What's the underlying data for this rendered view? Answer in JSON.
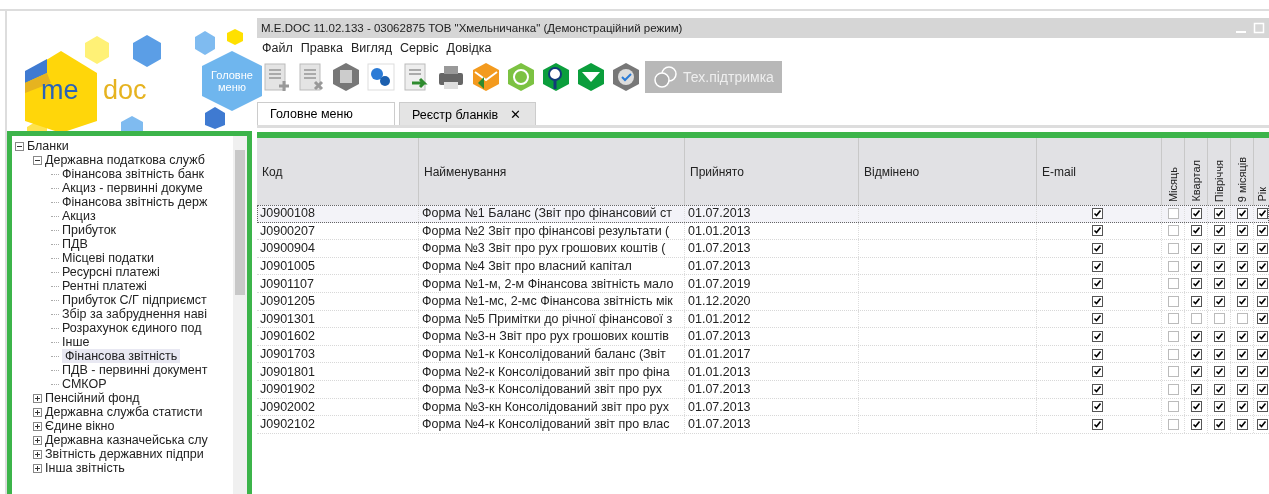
{
  "window": {
    "title": "M.E.DOC 11.02.133  - 03062875 ТОВ \"Хмельничанка\" (Демонстраційний режим)"
  },
  "logo": {
    "left": "me",
    "right": "doc"
  },
  "home_button": {
    "label": "Головне меню"
  },
  "menu": [
    "Файл",
    "Правка",
    "Вигляд",
    "Сервіс",
    "Довідка"
  ],
  "support_button": {
    "label": "Тех.підтримка",
    "disabled": true
  },
  "tabs": [
    {
      "label": "Головне меню",
      "selected": false
    },
    {
      "label": "Реєстр бланків",
      "selected": true,
      "close": "✕"
    }
  ],
  "tree": [
    {
      "label": "Бланки",
      "expanded": true,
      "children": [
        {
          "label": "Державна податкова служб",
          "expanded": true,
          "children": [
            {
              "label": "Фінансова звітність банк",
              "selected": false
            },
            {
              "label": "Акциз - первинні докуме",
              "selected": false
            },
            {
              "label": "Фінансова звітність держ",
              "selected": false
            },
            {
              "label": "Акциз",
              "selected": false
            },
            {
              "label": "Прибуток",
              "selected": false
            },
            {
              "label": "ПДВ",
              "selected": false
            },
            {
              "label": "Місцеві податки",
              "selected": false
            },
            {
              "label": "Ресурсні платежі",
              "selected": false
            },
            {
              "label": "Рентні платежі",
              "selected": false
            },
            {
              "label": "Прибуток С/Г підприємст",
              "selected": false
            },
            {
              "label": "Збір за забруднення наві",
              "selected": false
            },
            {
              "label": "Розрахунок єдиного под",
              "selected": false
            },
            {
              "label": "Інше",
              "selected": false
            },
            {
              "label": "Фінансова звітність",
              "selected": true
            },
            {
              "label": "ПДВ - первинні документ",
              "selected": false
            },
            {
              "label": "СМКОР",
              "selected": false
            }
          ]
        },
        {
          "label": "Пенсійний фонд",
          "expanded": false
        },
        {
          "label": "Державна служба статисти",
          "expanded": false
        },
        {
          "label": "Єдине вікно",
          "expanded": false
        },
        {
          "label": "Державна казначейська слу",
          "expanded": false
        },
        {
          "label": "Звітність державних підпри",
          "expanded": false
        },
        {
          "label": "Інша звітність",
          "expanded": false
        }
      ]
    }
  ],
  "table": {
    "columns": [
      "Код",
      "Найменування",
      "Прийнято",
      "Відмінено",
      "E-mail",
      "Місяць",
      "Квартал",
      "Півріччя",
      "9 місяців",
      "Рік"
    ],
    "rows": [
      {
        "code": "J0900108",
        "name": "Форма №1 Баланс (Звіт про фінансовий ст",
        "accepted": "01.07.2013",
        "email": true,
        "periods": [
          false,
          true,
          true,
          true,
          true
        ],
        "selected": true
      },
      {
        "code": "J0900207",
        "name": "Форма №2 Звіт про фінансові результати (",
        "accepted": "01.01.2013",
        "email": true,
        "periods": [
          false,
          true,
          true,
          true,
          true
        ],
        "selected": false
      },
      {
        "code": "J0900904",
        "name": "Форма №3 Звіт про рух грошових коштів  (",
        "accepted": "01.07.2013",
        "email": true,
        "periods": [
          false,
          true,
          true,
          true,
          true
        ],
        "selected": false
      },
      {
        "code": "J0901005",
        "name": "Форма №4 Звіт про власний капітал",
        "accepted": "01.07.2013",
        "email": true,
        "periods": [
          false,
          true,
          true,
          true,
          true
        ],
        "selected": false
      },
      {
        "code": "J0901107",
        "name": "Форма №1-м, 2-м Фінансова звітність мало",
        "accepted": "01.07.2019",
        "email": true,
        "periods": [
          false,
          true,
          true,
          true,
          true
        ],
        "selected": false
      },
      {
        "code": "J0901205",
        "name": "Форма №1-мс, 2-мс Фінансова звітність мік",
        "accepted": "01.12.2020",
        "email": true,
        "periods": [
          false,
          true,
          true,
          true,
          true
        ],
        "selected": false
      },
      {
        "code": "J0901301",
        "name": "Форма №5 Примітки до річної фінансової з",
        "accepted": "01.01.2012",
        "email": true,
        "periods": [
          false,
          false,
          false,
          false,
          true
        ],
        "selected": false
      },
      {
        "code": "J0901602",
        "name": "Форма №3-н Звіт про рух грошових коштів",
        "accepted": "01.07.2013",
        "email": true,
        "periods": [
          false,
          true,
          true,
          true,
          true
        ],
        "selected": false
      },
      {
        "code": "J0901703",
        "name": "Форма №1-к Консолідований баланс (Звіт",
        "accepted": "01.01.2017",
        "email": true,
        "periods": [
          false,
          true,
          true,
          true,
          true
        ],
        "selected": false
      },
      {
        "code": "J0901801",
        "name": "Форма №2-к Консолідований звіт про фіна",
        "accepted": "01.01.2013",
        "email": true,
        "periods": [
          false,
          true,
          true,
          true,
          true
        ],
        "selected": false
      },
      {
        "code": "J0901902",
        "name": "Форма №3-к Консолідований звіт про рух",
        "accepted": "01.07.2013",
        "email": true,
        "periods": [
          false,
          true,
          true,
          true,
          true
        ],
        "selected": false
      },
      {
        "code": "J0902002",
        "name": "Форма №3-кн Консолідований звіт про рух",
        "accepted": "01.07.2013",
        "email": true,
        "periods": [
          false,
          true,
          true,
          true,
          true
        ],
        "selected": false
      },
      {
        "code": "J0902102",
        "name": "Форма №4-к Консолідований звіт про влас",
        "accepted": "01.07.2013",
        "email": true,
        "periods": [
          false,
          true,
          true,
          true,
          true
        ],
        "selected": false
      }
    ]
  }
}
